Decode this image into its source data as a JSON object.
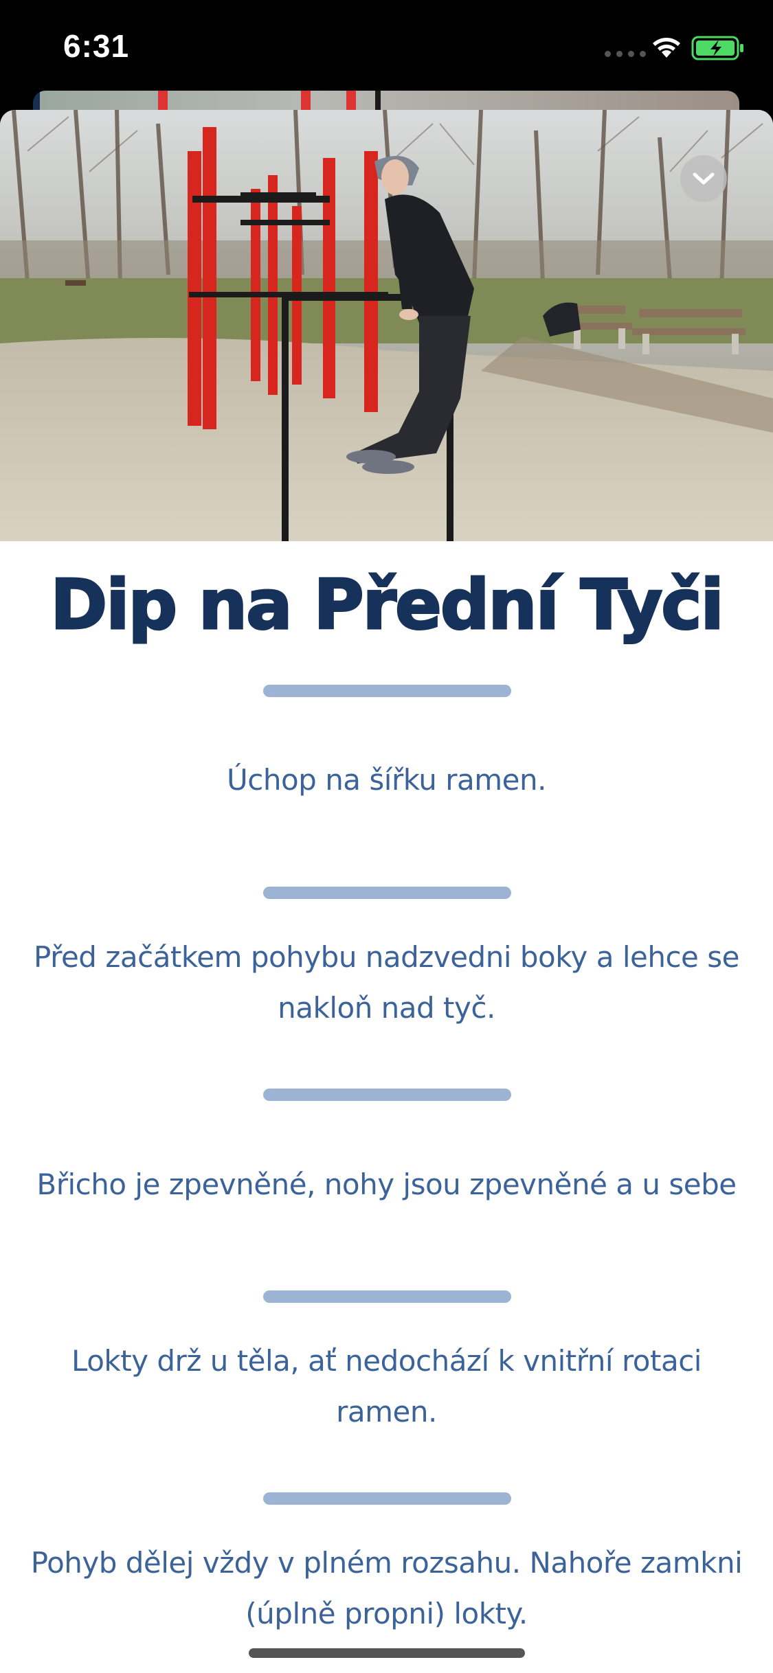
{
  "status_bar": {
    "time": "6:31"
  },
  "exercise": {
    "title": "Dip na Přední Tyči",
    "steps": [
      "Úchop na šířku ramen.",
      "Před začátkem pohybu nadzvedni boky a lehce se nakloň nad tyč.",
      "Břicho je zpevněné, nohy jsou zpevněné a u sebe",
      "Lokty drž u těla, ať nedochází k vnitřní rotaci ramen.",
      "Pohyb dělej vždy v plném rozsahu. Nahoře zamkni (úplně propni) lokty."
    ]
  },
  "icons": {
    "collapse": "chevron-down-icon",
    "wifi": "wifi-icon",
    "battery": "battery-charging-icon"
  },
  "colors": {
    "title": "#17325a",
    "step_text": "#3b639a",
    "divider": "#9db3d3",
    "battery": "#4cd964"
  }
}
